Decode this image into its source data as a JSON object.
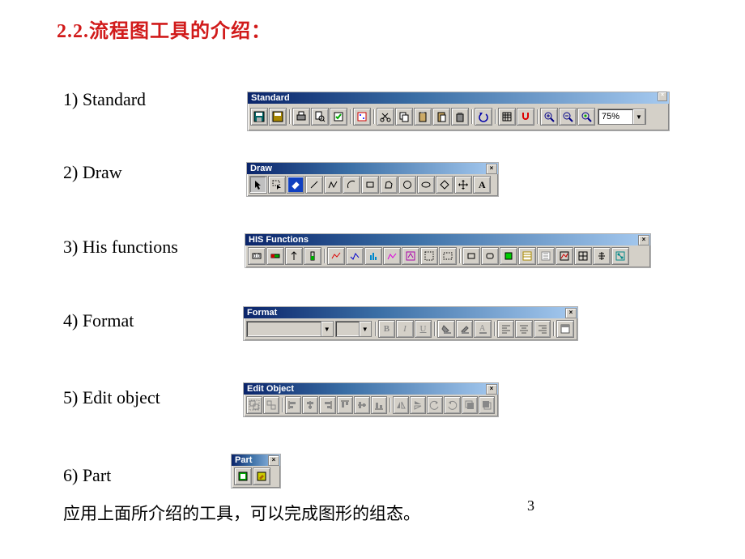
{
  "heading": "2.2.流程图工具的介绍：",
  "items": [
    {
      "label": "1)  Standard"
    },
    {
      "label": "2)   Draw"
    },
    {
      "label": "3)   His functions"
    },
    {
      "label": "4)    Format"
    },
    {
      "label": "5)     Edit object"
    },
    {
      "label": "6)    Part"
    }
  ],
  "footnote": "应用上面所介绍的工具，可以完成图形的组态。",
  "page_number": "3",
  "toolbars": {
    "standard": {
      "title": "Standard",
      "close": "×",
      "zoom": "75%",
      "zoom_arrow": "▼",
      "buttons": [
        {
          "n": "save-icon"
        },
        {
          "n": "save-partial-icon"
        },
        {
          "n": "print-icon"
        },
        {
          "n": "print-preview-icon"
        },
        {
          "n": "check-icon"
        },
        {
          "n": "properties-icon"
        },
        {
          "n": "cut-icon"
        },
        {
          "n": "copy-icon"
        },
        {
          "n": "paste-icon"
        },
        {
          "n": "paste-attr-icon"
        },
        {
          "n": "delete-icon"
        },
        {
          "n": "undo-icon"
        },
        {
          "n": "grid-icon"
        },
        {
          "n": "snap-icon"
        },
        {
          "n": "zoom-in-icon"
        },
        {
          "n": "zoom-out-icon"
        },
        {
          "n": "zoom-all-icon"
        }
      ]
    },
    "draw": {
      "title": "Draw",
      "close": "×",
      "buttons": [
        {
          "n": "pointer-icon"
        },
        {
          "n": "area-select-icon"
        },
        {
          "n": "eraser-icon",
          "highlight": true
        },
        {
          "n": "line-icon"
        },
        {
          "n": "polyline-icon"
        },
        {
          "n": "arc-icon"
        },
        {
          "n": "rectangle-icon"
        },
        {
          "n": "polygon-icon"
        },
        {
          "n": "ellipse-icon"
        },
        {
          "n": "oval-icon"
        },
        {
          "n": "diamond-icon"
        },
        {
          "n": "move-icon"
        },
        {
          "n": "text-icon"
        }
      ]
    },
    "his": {
      "title": "HIS Functions",
      "close": "×",
      "buttons": [
        {
          "n": "data-display-icon"
        },
        {
          "n": "data-bar-icon"
        },
        {
          "n": "marker-icon"
        },
        {
          "n": "level-icon"
        },
        {
          "n": "trend1-icon"
        },
        {
          "n": "trend2-icon"
        },
        {
          "n": "trend3-icon"
        },
        {
          "n": "trend4-icon"
        },
        {
          "n": "faceplate-icon"
        },
        {
          "n": "rect-tool-icon"
        },
        {
          "n": "window-icon"
        },
        {
          "n": "button-rect-icon"
        },
        {
          "n": "button-oval-icon"
        },
        {
          "n": "indicator-icon"
        },
        {
          "n": "list1-icon"
        },
        {
          "n": "list2-icon"
        },
        {
          "n": "chart-icon"
        },
        {
          "n": "grid2-icon"
        },
        {
          "n": "symbol-icon"
        },
        {
          "n": "link-icon"
        }
      ]
    },
    "format": {
      "title": "Format",
      "close": "×",
      "font_combo": "",
      "size_combo": "",
      "buttons": [
        {
          "n": "bold-icon",
          "label": "B"
        },
        {
          "n": "italic-icon",
          "label": "I"
        },
        {
          "n": "underline-icon",
          "label": "U"
        },
        {
          "n": "fill-icon"
        },
        {
          "n": "line-color-icon"
        },
        {
          "n": "text-color-icon"
        },
        {
          "n": "align-left-icon"
        },
        {
          "n": "align-center-icon"
        },
        {
          "n": "align-right-icon"
        },
        {
          "n": "props-icon"
        }
      ]
    },
    "edit": {
      "title": "Edit Object",
      "close": "×",
      "buttons": [
        {
          "n": "group-icon"
        },
        {
          "n": "ungroup-icon"
        },
        {
          "n": "align-l-icon"
        },
        {
          "n": "align-c-icon"
        },
        {
          "n": "align-r-icon"
        },
        {
          "n": "align-t-icon"
        },
        {
          "n": "align-m-icon"
        },
        {
          "n": "align-b-icon"
        },
        {
          "n": "flip-h-icon"
        },
        {
          "n": "flip-v-icon"
        },
        {
          "n": "rotate-l-icon"
        },
        {
          "n": "rotate-r-icon"
        },
        {
          "n": "front-icon"
        },
        {
          "n": "back-icon"
        }
      ]
    },
    "part": {
      "title": "Part",
      "close": "×",
      "buttons": [
        {
          "n": "part-insert-icon"
        },
        {
          "n": "part-edit-icon"
        }
      ]
    }
  }
}
